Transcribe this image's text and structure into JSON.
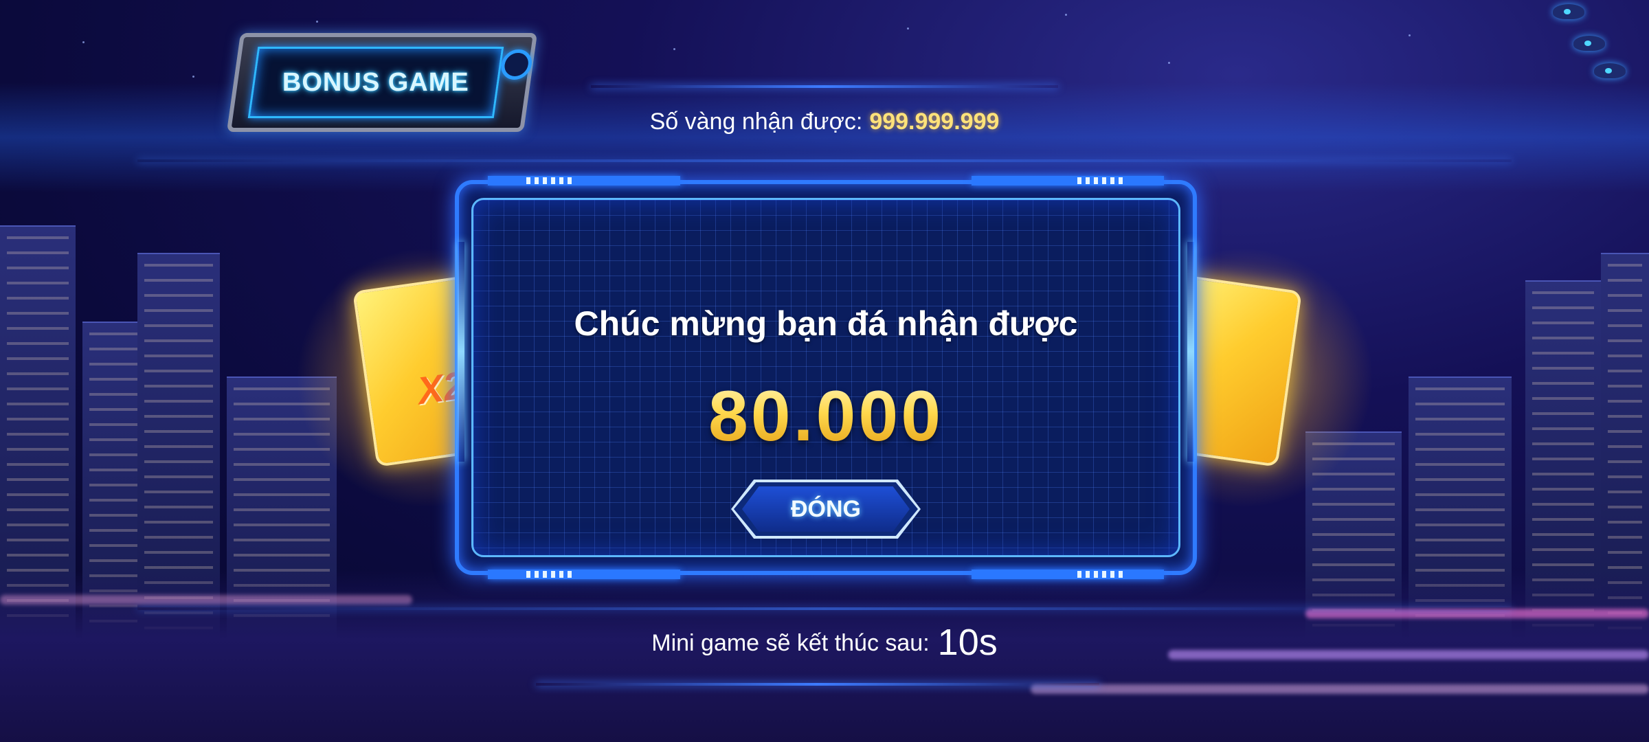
{
  "badge": {
    "title": "BONUS GAME"
  },
  "gold": {
    "label": "Số vàng nhận được:",
    "value": "999.999.999"
  },
  "side_cards": {
    "multiplier": "X2"
  },
  "dialog": {
    "message": "Chúc mừng bạn đá nhận được",
    "amount": "80.000",
    "close_label": "ĐÓNG"
  },
  "timer": {
    "label": "Mini game sẽ kết thúc sau:",
    "value": "10s"
  },
  "colors": {
    "accent": "#2f7bff",
    "gold": "#ffd24a",
    "text": "#ffffff"
  }
}
